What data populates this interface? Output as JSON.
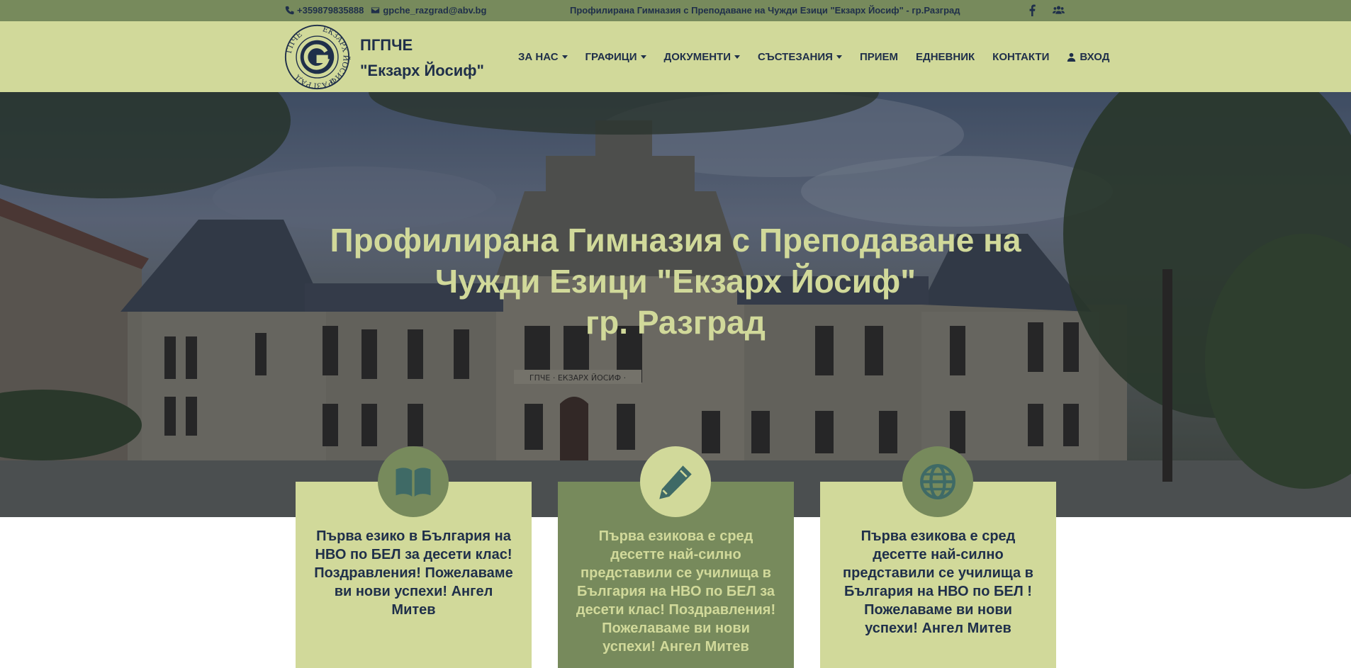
{
  "topbar": {
    "phone": "+359879835888",
    "email": "gpche_razgrad@abv.bg",
    "center_title": "Профилирана Гимназия с Преподаване на Чужди Езици \"Екзарх Йосиф\" - гр.Разград",
    "icons": [
      "phone-icon",
      "envelope-icon",
      "facebook-icon",
      "users-icon"
    ]
  },
  "header": {
    "logo_text_top": "ЕКЗАРХ ЙОСИФ",
    "logo_text_left": "ГПЧЕ",
    "logo_text_bottom": "РАЗГРАД",
    "brand_line1": "ПГПЧЕ",
    "brand_line2": "\"Екзарх Йосиф\""
  },
  "nav": {
    "about": "ЗА НАС",
    "schedules": "ГРАФИЦИ",
    "documents": "ДОКУМЕНТИ",
    "competitions": "СЪСТЕЗАНИЯ",
    "admission": "ПРИЕМ",
    "ediary": "ЕДНЕВНИК",
    "contacts": "КОНТАКТИ",
    "login": "ВХОД"
  },
  "hero": {
    "title_line1": "Профилирана Гимназия с Преподаване на",
    "title_line2": "Чужди Езици \"Екзарх Йосиф\"",
    "title_line3": "гр. Разград",
    "sign": "ГПЧЕ · ЕКЗАРХ ЙОСИФ ·"
  },
  "cards": [
    {
      "icon": "book-icon",
      "text": "Първа езико в България на НВО по БЕЛ за десети клас! Поздравления! Пожелаваме ви нови успехи! Ангел Митев"
    },
    {
      "icon": "pencil-icon",
      "text": "Първа езикова е сред десетте най-силно представили се училища в България на НВО по БЕЛ за десети клас! Поздравления! Пожелаваме ви нови успехи! Ангел Митев"
    },
    {
      "icon": "globe-icon",
      "text": "Първа езикова е сред десетте най-силно представили се училища в България на НВО по БЕЛ ! Пожелаваме ви нови успехи! Ангел Митев"
    }
  ],
  "colors": {
    "olive_dark": "#778a5c",
    "olive_light": "#d1d99a",
    "navy": "#1f2f4a",
    "teal_icon": "#3f6a66"
  }
}
